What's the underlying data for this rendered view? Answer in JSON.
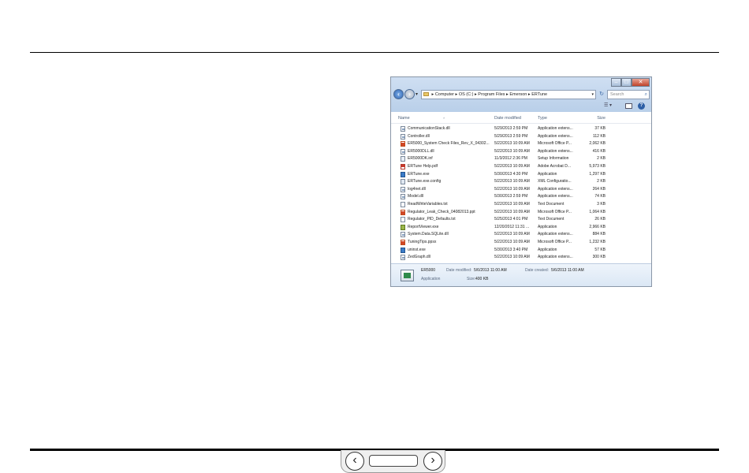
{
  "explorer": {
    "address_parts": [
      "Computer",
      "OS (C:)",
      "Program Files",
      "Emerson",
      "ERTune"
    ],
    "search_placeholder": "Search",
    "columns": {
      "name": "Name",
      "date": "Date modified",
      "type": "Type",
      "size": "Size"
    },
    "files": [
      {
        "icon": "dll",
        "name": "CommunicationStack.dll",
        "date": "5/29/2013 2:59 PM",
        "type": "Application extens...",
        "size": "37 KB"
      },
      {
        "icon": "dll",
        "name": "Controller.dll",
        "date": "5/29/2013 2:59 PM",
        "type": "Application extens...",
        "size": "112 KB"
      },
      {
        "icon": "ppt",
        "name": "ER5000_System Check Files_Rev_X_04302...",
        "date": "5/22/2013 10:09 AM",
        "type": "Microsoft Office P...",
        "size": "2,062 KB"
      },
      {
        "icon": "dll",
        "name": "ER5000DLL.dll",
        "date": "5/22/2013 10:09 AM",
        "type": "Application extens...",
        "size": "416 KB"
      },
      {
        "icon": "inf",
        "name": "ER5000DK.inf",
        "date": "11/3/2012 2:36 PM",
        "type": "Setup Information",
        "size": "2 KB"
      },
      {
        "icon": "pdf",
        "name": "ERTune Help.pdf",
        "date": "5/22/2013 10:09 AM",
        "type": "Adobe Acrobat D...",
        "size": "5,973 KB"
      },
      {
        "icon": "exe",
        "name": "ERTune.exe",
        "date": "5/30/2013 4:30 PM",
        "type": "Application",
        "size": "1,297 KB"
      },
      {
        "icon": "config",
        "name": "ERTune.exe.config",
        "date": "5/22/2013 10:09 AM",
        "type": "XML Configuratio...",
        "size": "2 KB"
      },
      {
        "icon": "dll",
        "name": "log4net.dll",
        "date": "5/22/2013 10:09 AM",
        "type": "Application extens...",
        "size": "264 KB"
      },
      {
        "icon": "dll",
        "name": "Model.dll",
        "date": "5/30/2013 2:59 PM",
        "type": "Application extens...",
        "size": "74 KB"
      },
      {
        "icon": "txt",
        "name": "ReadWriteVariables.txt",
        "date": "5/22/2013 10:09 AM",
        "type": "Text Document",
        "size": "3 KB"
      },
      {
        "icon": "ppt",
        "name": "Regulator_Leak_Check_04082013.ppt",
        "date": "5/22/2013 10:09 AM",
        "type": "Microsoft Office P...",
        "size": "1,064 KB"
      },
      {
        "icon": "txt",
        "name": "Regulator_PID_Defaults.txt",
        "date": "5/25/2013 4:01 PM",
        "type": "Text Document",
        "size": "26 KB"
      },
      {
        "icon": "app",
        "name": "ReportViewer.exe",
        "date": "12/20/2012 11:31 ...",
        "type": "Application",
        "size": "2,966 KB"
      },
      {
        "icon": "dll",
        "name": "System.Data.SQLite.dll",
        "date": "5/22/2013 10:09 AM",
        "type": "Application extens...",
        "size": "884 KB"
      },
      {
        "icon": "ppt",
        "name": "TuningTips.ppsx",
        "date": "5/22/2013 10:09 AM",
        "type": "Microsoft Office P...",
        "size": "1,232 KB"
      },
      {
        "icon": "exe",
        "name": "uninst.exe",
        "date": "5/30/2013 3:40 PM",
        "type": "Application",
        "size": "57 KB"
      },
      {
        "icon": "dll",
        "name": "ZedGraph.dll",
        "date": "5/22/2013 10:09 AM",
        "type": "Application extens...",
        "size": "300 KB"
      }
    ],
    "details": {
      "name": "ER5000",
      "kind": "Application",
      "modified_label": "Date modified:",
      "modified_value": "5/6/2013 11:00 AM",
      "created_label": "Date created:",
      "created_value": "5/6/2013 11:00 AM",
      "size_label": "Size:",
      "size_value": "400 KB"
    }
  },
  "icons": {
    "back": "‹",
    "forward": "›",
    "refresh": "↻",
    "search": "⌕",
    "help": "?",
    "views": "☰ ▾",
    "prev": "‹",
    "next": "›"
  }
}
